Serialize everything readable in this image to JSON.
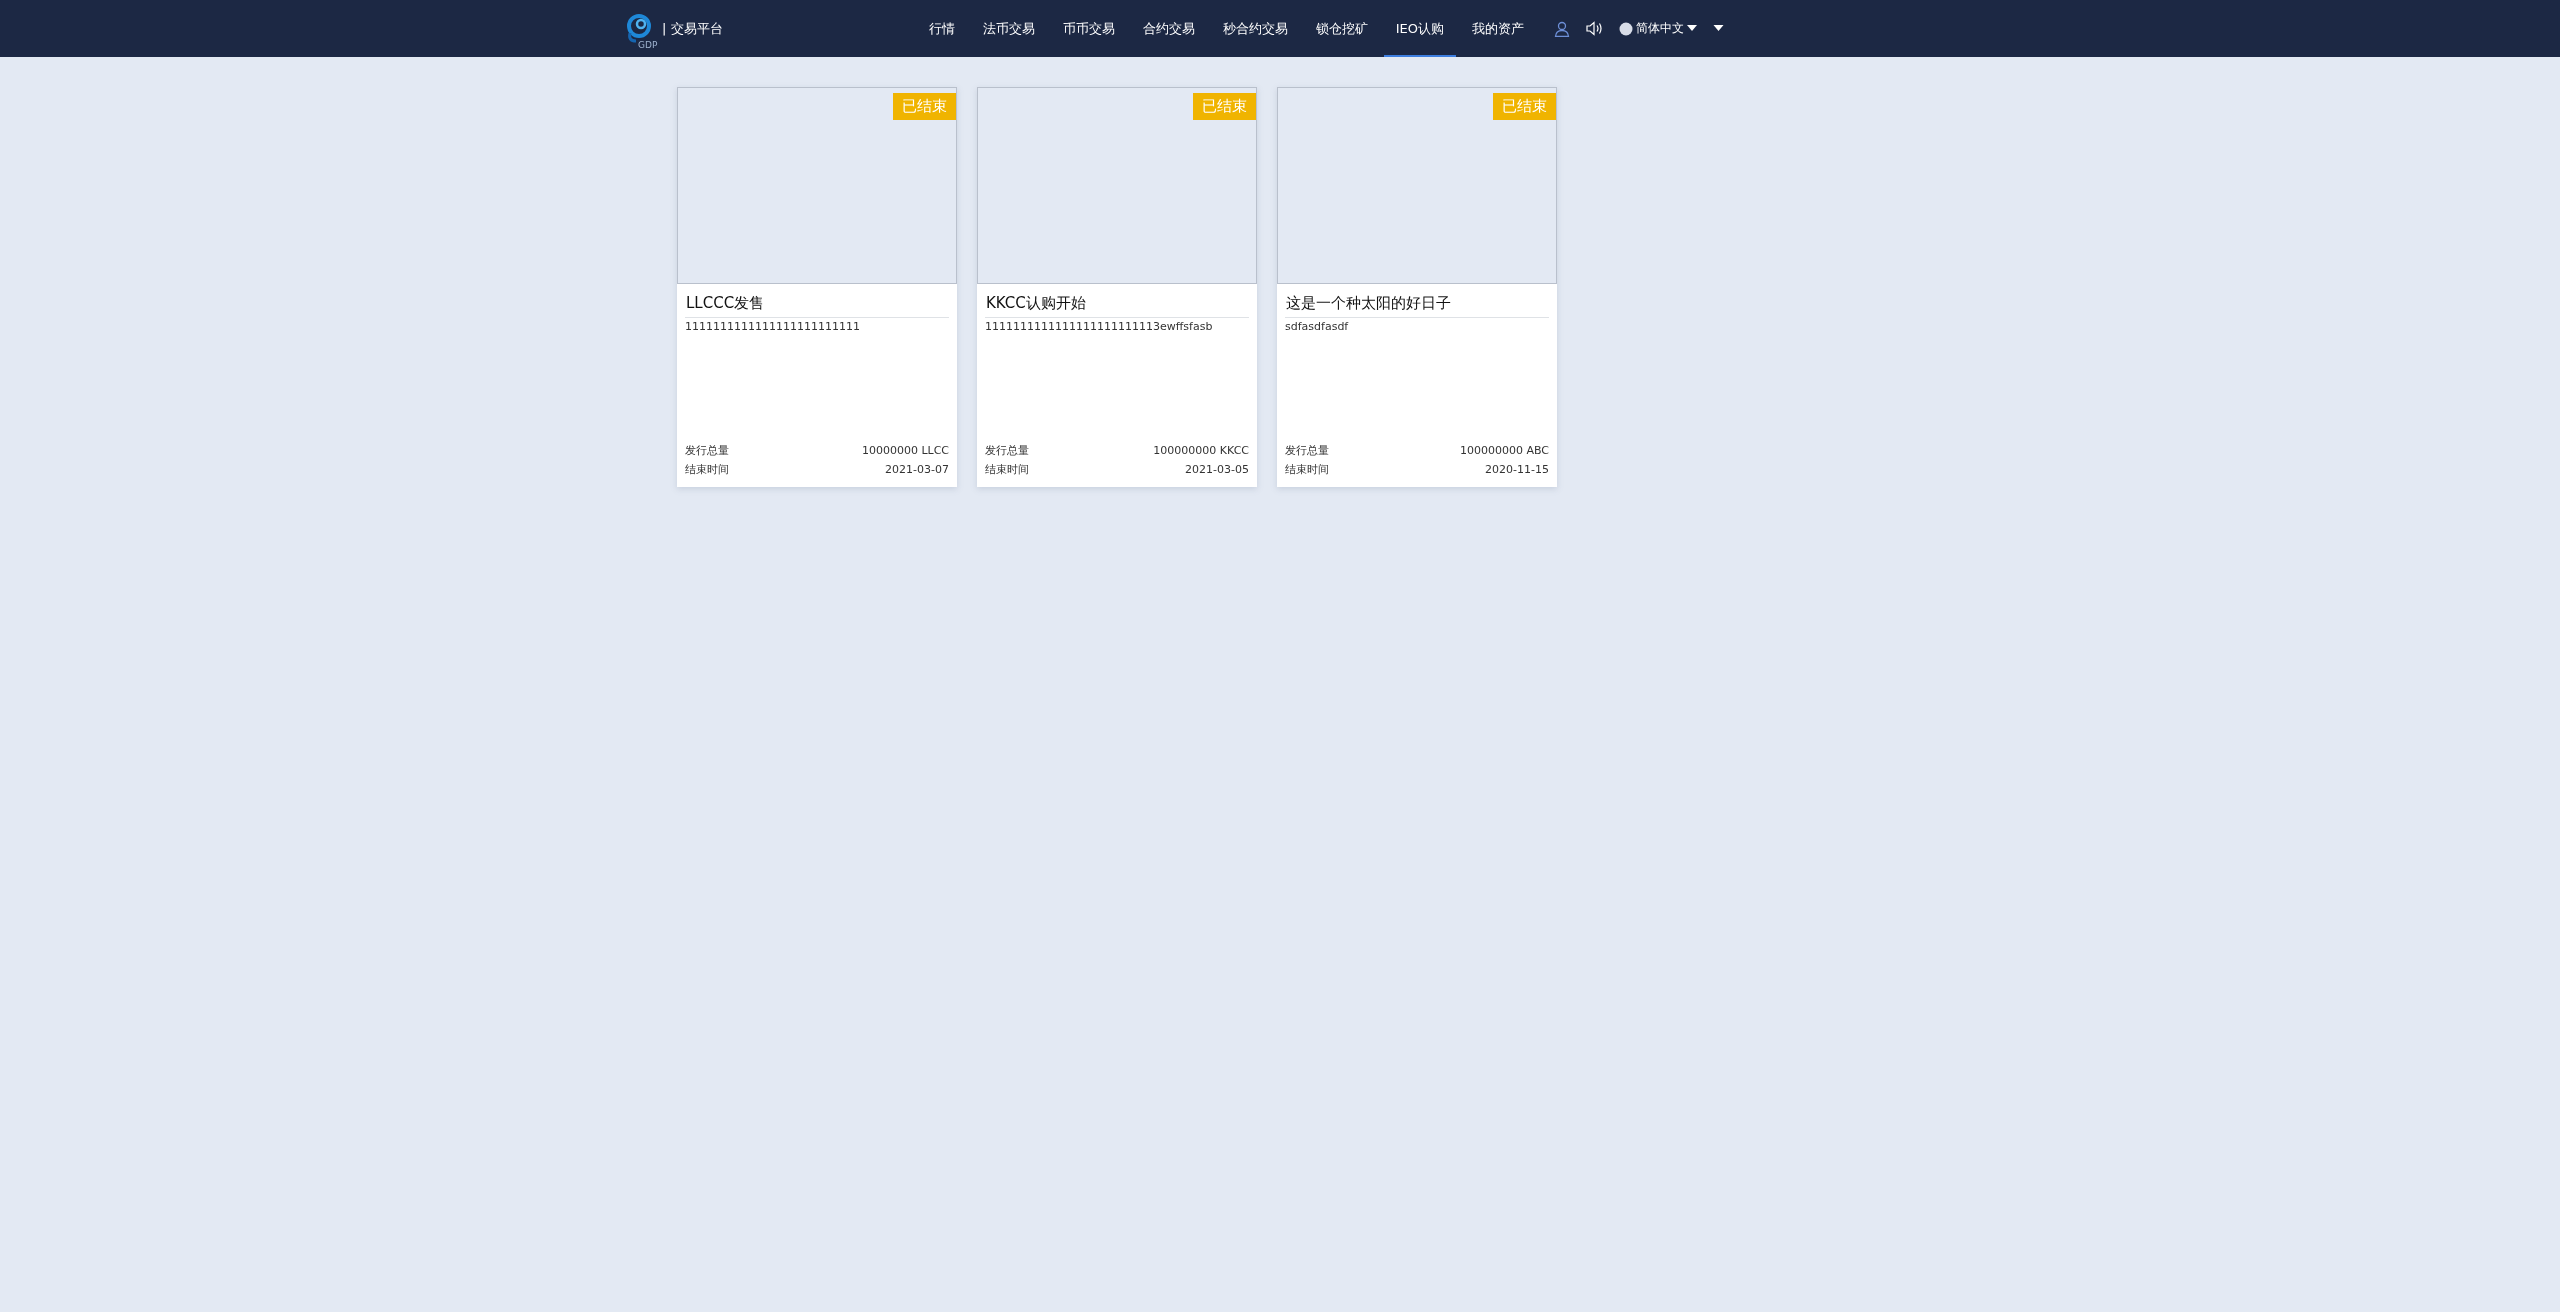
{
  "header": {
    "logo_text": "GDP",
    "brand": "| 交易平台",
    "nav": [
      {
        "label": "行情",
        "selected": false
      },
      {
        "label": "法币交易",
        "selected": false
      },
      {
        "label": "币币交易",
        "selected": false
      },
      {
        "label": "合约交易",
        "selected": false
      },
      {
        "label": "秒合约交易",
        "selected": false
      },
      {
        "label": "锁仓挖矿",
        "selected": false
      },
      {
        "label": "IEO认购",
        "selected": true
      },
      {
        "label": "我的资产",
        "selected": false
      }
    ],
    "language": "简体中文"
  },
  "projects": [
    {
      "badge": "已结束",
      "title": "LLCCC发售",
      "description": "1111111111111111111111111",
      "total_label": "发行总量",
      "total": "10000000 LLCC",
      "end_label": "结束时间",
      "end": "2021-03-07"
    },
    {
      "badge": "已结束",
      "title": "KKCC认购开始",
      "description": "1111111111111111111111113ewffsfasb",
      "total_label": "发行总量",
      "total": "100000000 KKCC",
      "end_label": "结束时间",
      "end": "2021-03-05"
    },
    {
      "badge": "已结束",
      "title": "这是一个种太阳的好日子",
      "description": "sdfasdfasdf",
      "total_label": "发行总量",
      "total": "100000000 ABC",
      "end_label": "结束时间",
      "end": "2020-11-15"
    }
  ]
}
